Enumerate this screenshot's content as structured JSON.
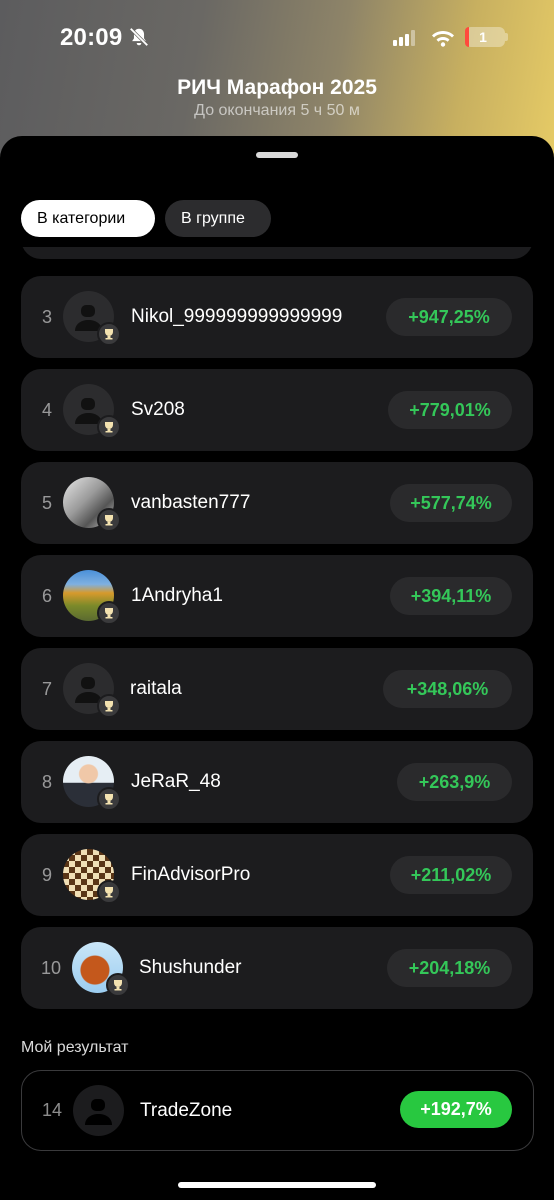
{
  "status_bar": {
    "time": "20:09",
    "battery_level": "1",
    "battery_fraction": 0.1
  },
  "header": {
    "title": "РИЧ Марафон 2025",
    "subtitle": "До окончания 5 ч 50 м"
  },
  "tabs": [
    {
      "label": "В категории",
      "active": true
    },
    {
      "label": "В группе",
      "active": false
    }
  ],
  "leaderboard": [
    {
      "rank": "3",
      "username": "Nikol_999999999999999",
      "change": "+947,25%",
      "avatar": "default-avatar-icon"
    },
    {
      "rank": "4",
      "username": "Sv208",
      "change": "+779,01%",
      "avatar": "default-avatar-icon"
    },
    {
      "rank": "5",
      "username": "vanbasten777",
      "change": "+577,74%",
      "avatar": "photo-avatar"
    },
    {
      "rank": "6",
      "username": "1Andryha1",
      "change": "+394,11%",
      "avatar": "landscape-photo-avatar"
    },
    {
      "rank": "7",
      "username": "raitala",
      "change": "+348,06%",
      "avatar": "default-avatar-icon"
    },
    {
      "rank": "8",
      "username": "JeRaR_48",
      "change": "+263,9%",
      "avatar": "person-photo-avatar"
    },
    {
      "rank": "9",
      "username": "FinAdvisorPro",
      "change": "+211,02%",
      "avatar": "chessboard-photo-avatar"
    },
    {
      "rank": "10",
      "username": "Shushunder",
      "change": "+204,18%",
      "avatar": "squirrel-photo-avatar"
    }
  ],
  "my_result": {
    "label": "Мой результат",
    "rank": "14",
    "username": "TradeZone",
    "change": "+192,7%"
  },
  "colors": {
    "positive": "#34c759",
    "accent_pill": "#28c840",
    "card": "#1c1c1e"
  }
}
